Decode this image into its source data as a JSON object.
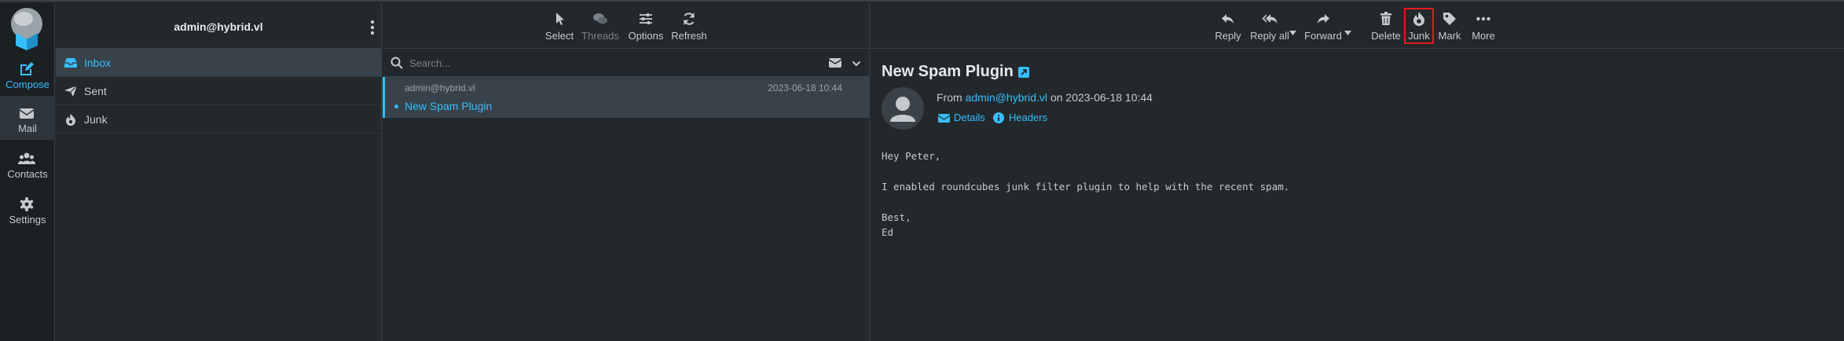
{
  "account": "admin@hybrid.vl",
  "nav": [
    {
      "label": "Compose",
      "icon": "compose-icon"
    },
    {
      "label": "Mail",
      "icon": "envelope-icon"
    },
    {
      "label": "Contacts",
      "icon": "contacts-icon"
    },
    {
      "label": "Settings",
      "icon": "gear-icon"
    }
  ],
  "folders": [
    {
      "label": "Inbox",
      "icon": "inbox-icon"
    },
    {
      "label": "Sent",
      "icon": "paper-plane-icon"
    },
    {
      "label": "Junk",
      "icon": "fire-icon"
    }
  ],
  "list_toolbar": {
    "select": "Select",
    "threads": "Threads",
    "options": "Options",
    "refresh": "Refresh"
  },
  "search": {
    "placeholder": "Search..."
  },
  "messages": [
    {
      "from": "admin@hybrid.vl",
      "date": "2023-06-18 10:44",
      "subject": "New Spam Plugin"
    }
  ],
  "reader_toolbar": {
    "reply": "Reply",
    "reply_all": "Reply all",
    "forward": "Forward",
    "delete": "Delete",
    "junk": "Junk",
    "mark": "Mark",
    "more": "More"
  },
  "email": {
    "subject": "New Spam Plugin",
    "from_prefix": "From",
    "from_address": "admin@hybrid.vl",
    "on_word": "on",
    "date": "2023-06-18 10:44",
    "details": "Details",
    "headers": "Headers",
    "body": [
      "Hey Peter,",
      "I enabled roundcubes junk filter plugin to help with the recent spam.",
      "Best,",
      "Ed"
    ]
  },
  "colors": {
    "accent": "#37beff",
    "background": "#22282b",
    "highlight": "#e21b1b"
  }
}
